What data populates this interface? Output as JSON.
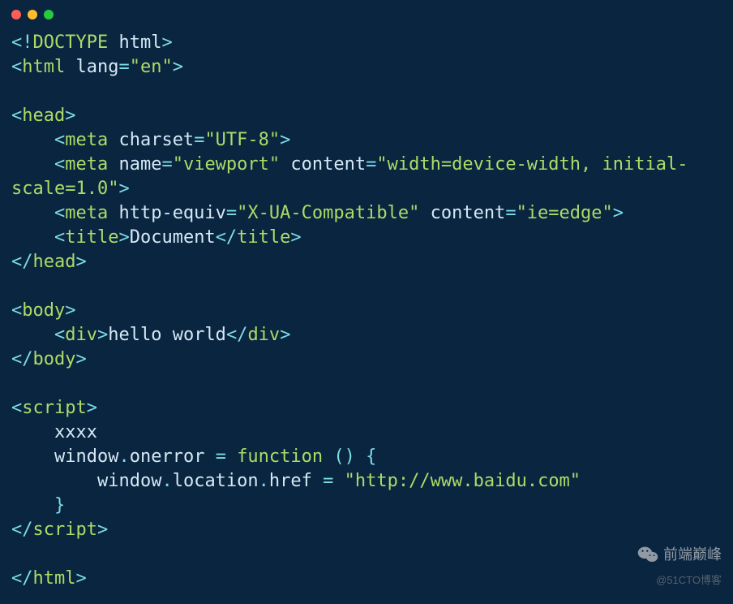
{
  "code_tokens": [
    {
      "t": "bracket",
      "v": "<!"
    },
    {
      "t": "tag",
      "v": "DOCTYPE"
    },
    {
      "t": "attr-name",
      "v": " html"
    },
    {
      "t": "bracket",
      "v": ">"
    },
    {
      "t": "newline"
    },
    {
      "t": "bracket",
      "v": "<"
    },
    {
      "t": "tag",
      "v": "html"
    },
    {
      "t": "attr-name",
      "v": " lang"
    },
    {
      "t": "operator",
      "v": "="
    },
    {
      "t": "attr-value",
      "v": "\"en\""
    },
    {
      "t": "bracket",
      "v": ">"
    },
    {
      "t": "newline"
    },
    {
      "t": "newline"
    },
    {
      "t": "bracket",
      "v": "<"
    },
    {
      "t": "tag",
      "v": "head"
    },
    {
      "t": "bracket",
      "v": ">"
    },
    {
      "t": "newline"
    },
    {
      "t": "text",
      "v": "    "
    },
    {
      "t": "bracket",
      "v": "<"
    },
    {
      "t": "tag",
      "v": "meta"
    },
    {
      "t": "attr-name",
      "v": " charset"
    },
    {
      "t": "operator",
      "v": "="
    },
    {
      "t": "attr-value",
      "v": "\"UTF-8\""
    },
    {
      "t": "bracket",
      "v": ">"
    },
    {
      "t": "newline"
    },
    {
      "t": "text",
      "v": "    "
    },
    {
      "t": "bracket",
      "v": "<"
    },
    {
      "t": "tag",
      "v": "meta"
    },
    {
      "t": "attr-name",
      "v": " name"
    },
    {
      "t": "operator",
      "v": "="
    },
    {
      "t": "attr-value",
      "v": "\"viewport\""
    },
    {
      "t": "attr-name",
      "v": " content"
    },
    {
      "t": "operator",
      "v": "="
    },
    {
      "t": "attr-value",
      "v": "\"width=device-width, initial-scale=1.0\""
    },
    {
      "t": "bracket",
      "v": ">"
    },
    {
      "t": "newline"
    },
    {
      "t": "text",
      "v": "    "
    },
    {
      "t": "bracket",
      "v": "<"
    },
    {
      "t": "tag",
      "v": "meta"
    },
    {
      "t": "attr-name",
      "v": " http-equiv"
    },
    {
      "t": "operator",
      "v": "="
    },
    {
      "t": "attr-value",
      "v": "\"X-UA-Compatible\""
    },
    {
      "t": "attr-name",
      "v": " content"
    },
    {
      "t": "operator",
      "v": "="
    },
    {
      "t": "attr-value",
      "v": "\"ie=edge\""
    },
    {
      "t": "bracket",
      "v": ">"
    },
    {
      "t": "newline"
    },
    {
      "t": "text",
      "v": "    "
    },
    {
      "t": "bracket",
      "v": "<"
    },
    {
      "t": "tag",
      "v": "title"
    },
    {
      "t": "bracket",
      "v": ">"
    },
    {
      "t": "text",
      "v": "Document"
    },
    {
      "t": "bracket",
      "v": "</"
    },
    {
      "t": "tag",
      "v": "title"
    },
    {
      "t": "bracket",
      "v": ">"
    },
    {
      "t": "newline"
    },
    {
      "t": "bracket",
      "v": "</"
    },
    {
      "t": "tag",
      "v": "head"
    },
    {
      "t": "bracket",
      "v": ">"
    },
    {
      "t": "newline"
    },
    {
      "t": "newline"
    },
    {
      "t": "bracket",
      "v": "<"
    },
    {
      "t": "tag",
      "v": "body"
    },
    {
      "t": "bracket",
      "v": ">"
    },
    {
      "t": "newline"
    },
    {
      "t": "text",
      "v": "    "
    },
    {
      "t": "bracket",
      "v": "<"
    },
    {
      "t": "tag",
      "v": "div"
    },
    {
      "t": "bracket",
      "v": ">"
    },
    {
      "t": "text",
      "v": "hello world"
    },
    {
      "t": "bracket",
      "v": "</"
    },
    {
      "t": "tag",
      "v": "div"
    },
    {
      "t": "bracket",
      "v": ">"
    },
    {
      "t": "newline"
    },
    {
      "t": "bracket",
      "v": "</"
    },
    {
      "t": "tag",
      "v": "body"
    },
    {
      "t": "bracket",
      "v": ">"
    },
    {
      "t": "newline"
    },
    {
      "t": "newline"
    },
    {
      "t": "bracket",
      "v": "<"
    },
    {
      "t": "tag",
      "v": "script"
    },
    {
      "t": "bracket",
      "v": ">"
    },
    {
      "t": "newline"
    },
    {
      "t": "text",
      "v": "    xxxx"
    },
    {
      "t": "newline"
    },
    {
      "t": "text",
      "v": "    window"
    },
    {
      "t": "operator",
      "v": "."
    },
    {
      "t": "text",
      "v": "onerror "
    },
    {
      "t": "operator",
      "v": "="
    },
    {
      "t": "text",
      "v": " "
    },
    {
      "t": "keyword",
      "v": "function"
    },
    {
      "t": "text",
      "v": " "
    },
    {
      "t": "operator",
      "v": "()"
    },
    {
      "t": "text",
      "v": " "
    },
    {
      "t": "operator",
      "v": "{"
    },
    {
      "t": "newline"
    },
    {
      "t": "text",
      "v": "        window"
    },
    {
      "t": "operator",
      "v": "."
    },
    {
      "t": "text",
      "v": "location"
    },
    {
      "t": "operator",
      "v": "."
    },
    {
      "t": "text",
      "v": "href "
    },
    {
      "t": "operator",
      "v": "="
    },
    {
      "t": "text",
      "v": " "
    },
    {
      "t": "string",
      "v": "\"http://www.baidu.com\""
    },
    {
      "t": "newline"
    },
    {
      "t": "text",
      "v": "    "
    },
    {
      "t": "operator",
      "v": "}"
    },
    {
      "t": "newline"
    },
    {
      "t": "bracket",
      "v": "</"
    },
    {
      "t": "tag",
      "v": "script"
    },
    {
      "t": "bracket",
      "v": ">"
    },
    {
      "t": "newline"
    },
    {
      "t": "newline"
    },
    {
      "t": "bracket",
      "v": "</"
    },
    {
      "t": "tag",
      "v": "html"
    },
    {
      "t": "bracket",
      "v": ">"
    }
  ],
  "watermark": {
    "brand": "前端巅峰",
    "subtitle": "@51CTO博客"
  }
}
